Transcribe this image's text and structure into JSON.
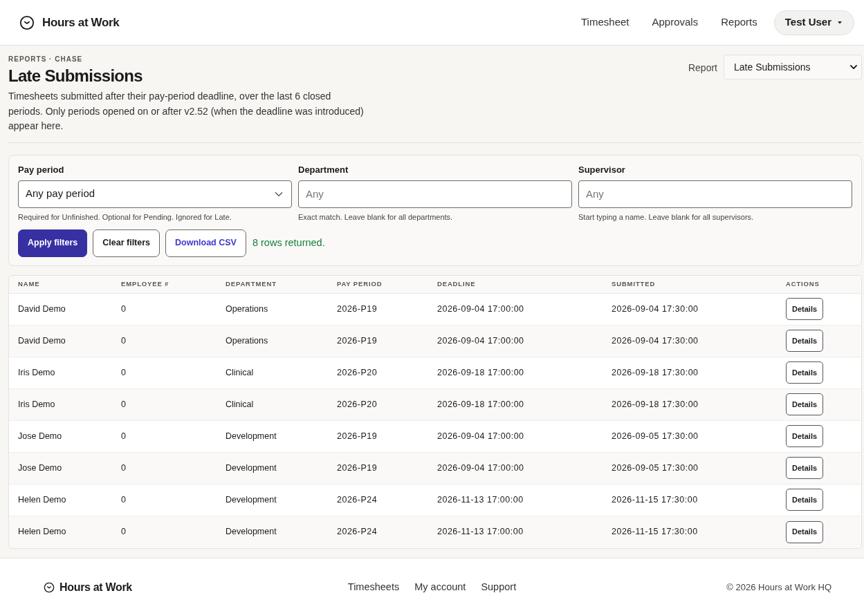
{
  "header": {
    "brand": "Hours at Work",
    "nav": [
      {
        "label": "Timesheet"
      },
      {
        "label": "Approvals"
      },
      {
        "label": "Reports"
      }
    ],
    "user_menu": {
      "label": "Test User"
    }
  },
  "page": {
    "breadcrumb": "REPORTS · CHASE",
    "title": "Late Submissions",
    "description": "Timesheets submitted after their pay-period deadline, over the last 6 closed periods. Only periods opened on or after v2.52 (when the deadline was introduced) appear here.",
    "report_select": {
      "label": "Report",
      "value": "Late Submissions"
    }
  },
  "filters": {
    "fields": [
      {
        "kind": "select",
        "label": "Pay period",
        "value": "Any pay period",
        "hint": "Required for Unfinished. Optional for Pending. Ignored for Late."
      },
      {
        "kind": "text",
        "label": "Department",
        "placeholder": "Any",
        "hint": "Exact match. Leave blank for all departments."
      },
      {
        "kind": "text",
        "label": "Supervisor",
        "placeholder": "Any",
        "hint": "Start typing a name. Leave blank for all supervisors."
      }
    ],
    "buttons": [
      {
        "kind": "primary",
        "label": "Apply filters"
      },
      {
        "kind": "secondary",
        "label": "Clear filters"
      },
      {
        "kind": "accent",
        "label": "Download CSV"
      }
    ],
    "status": "8 rows returned."
  },
  "table": {
    "columns": [
      "NAME",
      "EMPLOYEE #",
      "DEPARTMENT",
      "PAY PERIOD",
      "DEADLINE",
      "SUBMITTED",
      "ACTIONS"
    ],
    "rows": [
      {
        "cells": [
          "David Demo",
          "0",
          "Operations",
          "2026-P19",
          "2026-09-04 17:00:00",
          "2026-09-04 17:30:00"
        ],
        "action": "Details"
      },
      {
        "cells": [
          "David Demo",
          "0",
          "Operations",
          "2026-P19",
          "2026-09-04 17:00:00",
          "2026-09-04 17:30:00"
        ],
        "action": "Details"
      },
      {
        "cells": [
          "Iris Demo",
          "0",
          "Clinical",
          "2026-P20",
          "2026-09-18 17:00:00",
          "2026-09-18 17:30:00"
        ],
        "action": "Details"
      },
      {
        "cells": [
          "Iris Demo",
          "0",
          "Clinical",
          "2026-P20",
          "2026-09-18 17:00:00",
          "2026-09-18 17:30:00"
        ],
        "action": "Details"
      },
      {
        "cells": [
          "Jose Demo",
          "0",
          "Development",
          "2026-P19",
          "2026-09-04 17:00:00",
          "2026-09-05 17:30:00"
        ],
        "action": "Details"
      },
      {
        "cells": [
          "Jose Demo",
          "0",
          "Development",
          "2026-P19",
          "2026-09-04 17:00:00",
          "2026-09-05 17:30:00"
        ],
        "action": "Details"
      },
      {
        "cells": [
          "Helen Demo",
          "0",
          "Development",
          "2026-P24",
          "2026-11-13 17:00:00",
          "2026-11-15 17:30:00"
        ],
        "action": "Details"
      },
      {
        "cells": [
          "Helen Demo",
          "0",
          "Development",
          "2026-P24",
          "2026-11-13 17:00:00",
          "2026-11-15 17:30:00"
        ],
        "action": "Details"
      }
    ]
  },
  "footer": {
    "brand": "Hours at Work",
    "links": [
      {
        "label": "Timesheets"
      },
      {
        "label": "My account"
      },
      {
        "label": "Support"
      }
    ],
    "copyright": "© 2026 Hours at Work HQ"
  }
}
